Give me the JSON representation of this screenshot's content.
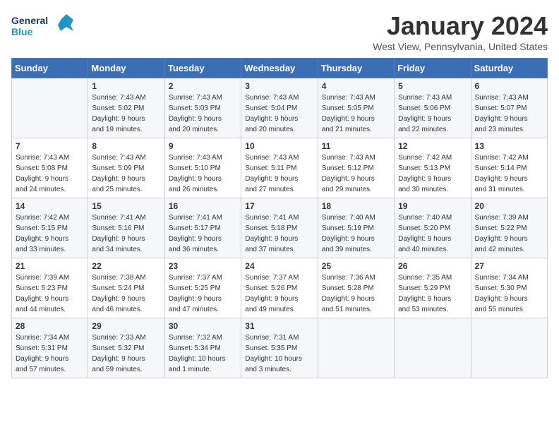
{
  "header": {
    "logo_line1": "General",
    "logo_line2": "Blue",
    "title": "January 2024",
    "subtitle": "West View, Pennsylvania, United States"
  },
  "days_of_week": [
    "Sunday",
    "Monday",
    "Tuesday",
    "Wednesday",
    "Thursday",
    "Friday",
    "Saturday"
  ],
  "weeks": [
    [
      {
        "day": "",
        "info": ""
      },
      {
        "day": "1",
        "info": "Sunrise: 7:43 AM\nSunset: 5:02 PM\nDaylight: 9 hours\nand 19 minutes."
      },
      {
        "day": "2",
        "info": "Sunrise: 7:43 AM\nSunset: 5:03 PM\nDaylight: 9 hours\nand 20 minutes."
      },
      {
        "day": "3",
        "info": "Sunrise: 7:43 AM\nSunset: 5:04 PM\nDaylight: 9 hours\nand 20 minutes."
      },
      {
        "day": "4",
        "info": "Sunrise: 7:43 AM\nSunset: 5:05 PM\nDaylight: 9 hours\nand 21 minutes."
      },
      {
        "day": "5",
        "info": "Sunrise: 7:43 AM\nSunset: 5:06 PM\nDaylight: 9 hours\nand 22 minutes."
      },
      {
        "day": "6",
        "info": "Sunrise: 7:43 AM\nSunset: 5:07 PM\nDaylight: 9 hours\nand 23 minutes."
      }
    ],
    [
      {
        "day": "7",
        "info": "Sunrise: 7:43 AM\nSunset: 5:08 PM\nDaylight: 9 hours\nand 24 minutes."
      },
      {
        "day": "8",
        "info": "Sunrise: 7:43 AM\nSunset: 5:09 PM\nDaylight: 9 hours\nand 25 minutes."
      },
      {
        "day": "9",
        "info": "Sunrise: 7:43 AM\nSunset: 5:10 PM\nDaylight: 9 hours\nand 26 minutes."
      },
      {
        "day": "10",
        "info": "Sunrise: 7:43 AM\nSunset: 5:11 PM\nDaylight: 9 hours\nand 27 minutes."
      },
      {
        "day": "11",
        "info": "Sunrise: 7:43 AM\nSunset: 5:12 PM\nDaylight: 9 hours\nand 29 minutes."
      },
      {
        "day": "12",
        "info": "Sunrise: 7:42 AM\nSunset: 5:13 PM\nDaylight: 9 hours\nand 30 minutes."
      },
      {
        "day": "13",
        "info": "Sunrise: 7:42 AM\nSunset: 5:14 PM\nDaylight: 9 hours\nand 31 minutes."
      }
    ],
    [
      {
        "day": "14",
        "info": "Sunrise: 7:42 AM\nSunset: 5:15 PM\nDaylight: 9 hours\nand 33 minutes."
      },
      {
        "day": "15",
        "info": "Sunrise: 7:41 AM\nSunset: 5:16 PM\nDaylight: 9 hours\nand 34 minutes."
      },
      {
        "day": "16",
        "info": "Sunrise: 7:41 AM\nSunset: 5:17 PM\nDaylight: 9 hours\nand 36 minutes."
      },
      {
        "day": "17",
        "info": "Sunrise: 7:41 AM\nSunset: 5:18 PM\nDaylight: 9 hours\nand 37 minutes."
      },
      {
        "day": "18",
        "info": "Sunrise: 7:40 AM\nSunset: 5:19 PM\nDaylight: 9 hours\nand 39 minutes."
      },
      {
        "day": "19",
        "info": "Sunrise: 7:40 AM\nSunset: 5:20 PM\nDaylight: 9 hours\nand 40 minutes."
      },
      {
        "day": "20",
        "info": "Sunrise: 7:39 AM\nSunset: 5:22 PM\nDaylight: 9 hours\nand 42 minutes."
      }
    ],
    [
      {
        "day": "21",
        "info": "Sunrise: 7:39 AM\nSunset: 5:23 PM\nDaylight: 9 hours\nand 44 minutes."
      },
      {
        "day": "22",
        "info": "Sunrise: 7:38 AM\nSunset: 5:24 PM\nDaylight: 9 hours\nand 46 minutes."
      },
      {
        "day": "23",
        "info": "Sunrise: 7:37 AM\nSunset: 5:25 PM\nDaylight: 9 hours\nand 47 minutes."
      },
      {
        "day": "24",
        "info": "Sunrise: 7:37 AM\nSunset: 5:26 PM\nDaylight: 9 hours\nand 49 minutes."
      },
      {
        "day": "25",
        "info": "Sunrise: 7:36 AM\nSunset: 5:28 PM\nDaylight: 9 hours\nand 51 minutes."
      },
      {
        "day": "26",
        "info": "Sunrise: 7:35 AM\nSunset: 5:29 PM\nDaylight: 9 hours\nand 53 minutes."
      },
      {
        "day": "27",
        "info": "Sunrise: 7:34 AM\nSunset: 5:30 PM\nDaylight: 9 hours\nand 55 minutes."
      }
    ],
    [
      {
        "day": "28",
        "info": "Sunrise: 7:34 AM\nSunset: 5:31 PM\nDaylight: 9 hours\nand 57 minutes."
      },
      {
        "day": "29",
        "info": "Sunrise: 7:33 AM\nSunset: 5:32 PM\nDaylight: 9 hours\nand 59 minutes."
      },
      {
        "day": "30",
        "info": "Sunrise: 7:32 AM\nSunset: 5:34 PM\nDaylight: 10 hours\nand 1 minute."
      },
      {
        "day": "31",
        "info": "Sunrise: 7:31 AM\nSunset: 5:35 PM\nDaylight: 10 hours\nand 3 minutes."
      },
      {
        "day": "",
        "info": ""
      },
      {
        "day": "",
        "info": ""
      },
      {
        "day": "",
        "info": ""
      }
    ]
  ]
}
